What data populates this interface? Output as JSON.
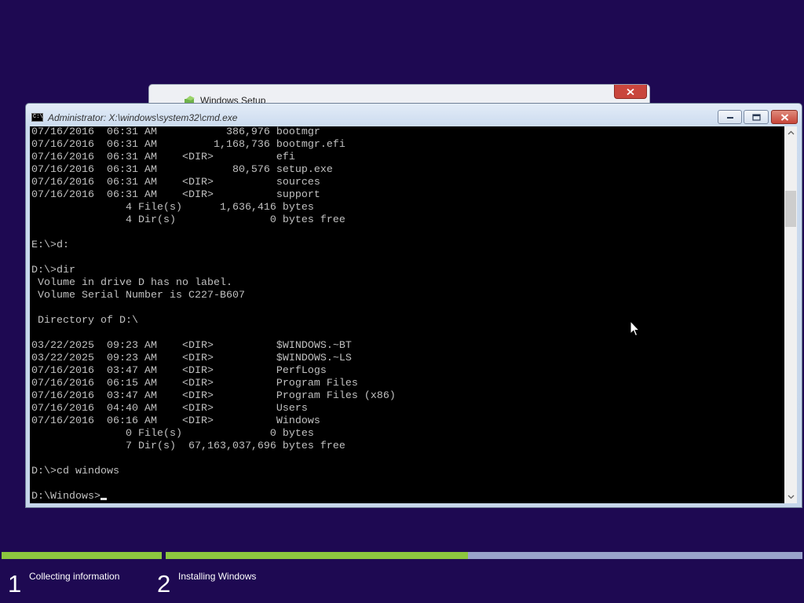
{
  "background_window": {
    "title": "Windows Setup"
  },
  "cmd_window": {
    "title": "Administrator: X:\\windows\\system32\\cmd.exe",
    "icon_text": "C:\\"
  },
  "console": {
    "lines": [
      "07/16/2016  06:31 AM           386,976 bootmgr",
      "07/16/2016  06:31 AM         1,168,736 bootmgr.efi",
      "07/16/2016  06:31 AM    <DIR>          efi",
      "07/16/2016  06:31 AM            80,576 setup.exe",
      "07/16/2016  06:31 AM    <DIR>          sources",
      "07/16/2016  06:31 AM    <DIR>          support",
      "               4 File(s)      1,636,416 bytes",
      "               4 Dir(s)               0 bytes free",
      "",
      "E:\\>d:",
      "",
      "D:\\>dir",
      " Volume in drive D has no label.",
      " Volume Serial Number is C227-B607",
      "",
      " Directory of D:\\",
      "",
      "03/22/2025  09:23 AM    <DIR>          $WINDOWS.~BT",
      "03/22/2025  09:23 AM    <DIR>          $WINDOWS.~LS",
      "07/16/2016  03:47 AM    <DIR>          PerfLogs",
      "07/16/2016  06:15 AM    <DIR>          Program Files",
      "07/16/2016  03:47 AM    <DIR>          Program Files (x86)",
      "07/16/2016  04:40 AM    <DIR>          Users",
      "07/16/2016  06:16 AM    <DIR>          Windows",
      "               0 File(s)              0 bytes",
      "               7 Dir(s)  67,163,037,696 bytes free",
      "",
      "D:\\>cd windows",
      ""
    ],
    "prompt": "D:\\Windows>"
  },
  "setup_progress": {
    "steps": [
      {
        "number": "1",
        "label": "Collecting information",
        "progress": 1.0
      },
      {
        "number": "2",
        "label": "Installing Windows",
        "progress": 0.475
      }
    ]
  },
  "icons": {
    "setup_icon": "windows-setup-icon",
    "cmd_icon": "cmd-icon",
    "minimize": "minimize-icon",
    "maximize": "maximize-icon",
    "close": "close-icon",
    "scroll_up": "chevron-up-icon",
    "scroll_down": "chevron-down-icon",
    "pointer": "mouse-pointer-icon"
  },
  "colors": {
    "background": "#1e0952",
    "console_background": "#000000",
    "console_text": "#c0c0c0",
    "progress_done": "#8cc63f",
    "progress_track": "#9aa3cc",
    "close_button": "#c9463d"
  }
}
